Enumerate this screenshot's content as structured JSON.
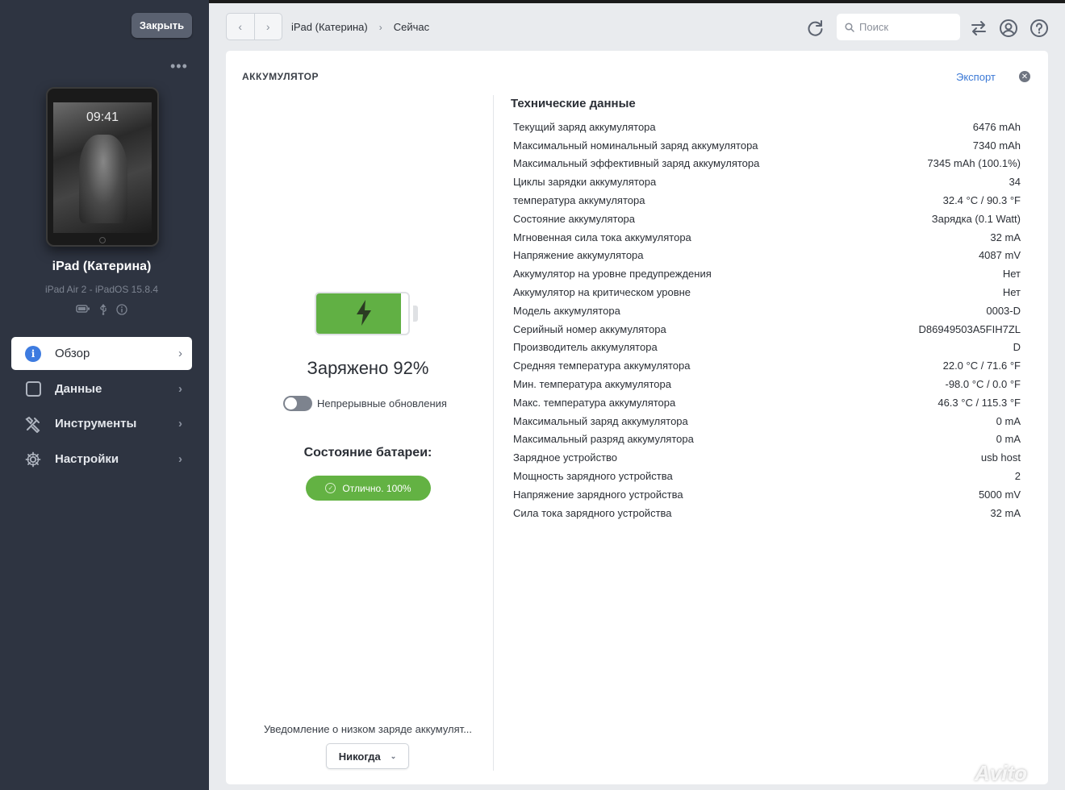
{
  "sidebar": {
    "close_label": "Закрыть",
    "more": "•••",
    "device": {
      "clock": "09:41",
      "name": "iPad (Катерина)",
      "model": "iPad Air 2 - iPadOS 15.8.4",
      "icons": [
        "battery-icon",
        "usb-icon",
        "info-icon"
      ]
    },
    "items": [
      {
        "label": "Обзор",
        "icon": "info-icon",
        "active": true
      },
      {
        "label": "Данные",
        "icon": "square-icon",
        "active": false
      },
      {
        "label": "Инструменты",
        "icon": "tools-icon",
        "active": false
      },
      {
        "label": "Настройки",
        "icon": "gear-icon",
        "active": false
      }
    ]
  },
  "toolbar": {
    "back": "‹",
    "forward": "›",
    "breadcrumb": [
      "iPad (Катерина)",
      "Сейчас"
    ],
    "search_placeholder": "Поиск"
  },
  "panel": {
    "title": "АККУМУЛЯТОР",
    "export_label": "Экспорт",
    "charge_percent": 92,
    "charged_text": "Заряжено 92%",
    "continuous_updates_label": "Непрерывные обновления",
    "continuous_updates_on": false,
    "state_title": "Состояние батареи:",
    "state_badge": "Отлично. 100%",
    "low_charge_label": "Уведомление о низком заряде аккумулят...",
    "low_charge_value": "Никогда"
  },
  "tech": {
    "title": "Технические данные",
    "rows": [
      {
        "label": "Текущий заряд аккумулятора",
        "value": "6476 mAh"
      },
      {
        "label": "Максимальный номинальный заряд аккумулятора",
        "value": "7340 mAh"
      },
      {
        "label": "Максимальный эффективный заряд аккумулятора",
        "value": "7345 mAh (100.1%)"
      },
      {
        "label": "Циклы зарядки аккумулятора",
        "value": "34"
      },
      {
        "label": "температура аккумулятора",
        "value": "32.4 °C / 90.3 °F"
      },
      {
        "label": "Состояние аккумулятора",
        "value": "Зарядка (0.1 Watt)"
      },
      {
        "label": "Мгновенная сила тока аккумулятора",
        "value": "32 mA"
      },
      {
        "label": "Напряжение аккумулятора",
        "value": "4087 mV"
      },
      {
        "label": "Аккумулятор на уровне предупреждения",
        "value": "Нет"
      },
      {
        "label": "Аккумулятор на критическом уровне",
        "value": "Нет"
      },
      {
        "label": "Модель аккумулятора",
        "value": "0003-D"
      },
      {
        "label": "Серийный номер аккумулятора",
        "value": "D86949503A5FIH7ZL"
      },
      {
        "label": "Производитель аккумулятора",
        "value": "D"
      },
      {
        "label": "Средняя температура аккумулятора",
        "value": "22.0 °C / 71.6 °F"
      },
      {
        "label": "Мин. температура аккумулятора",
        "value": "-98.0 °C / 0.0 °F"
      },
      {
        "label": "Макс. температура аккумулятора",
        "value": "46.3 °C / 115.3 °F"
      },
      {
        "label": "Максимальный заряд аккумулятора",
        "value": "0 mA"
      },
      {
        "label": "Максимальный разряд аккумулятора",
        "value": "0 mA"
      },
      {
        "label": "Зарядное устройство",
        "value": "usb host"
      },
      {
        "label": "Мощность зарядного устройства",
        "value": "2"
      },
      {
        "label": "Напряжение зарядного устройства",
        "value": "5000 mV"
      },
      {
        "label": "Сила тока зарядного устройства",
        "value": "32 mA"
      }
    ]
  },
  "watermark": "Avito",
  "colors": {
    "sidebar_bg": "#2e3441",
    "battery_green": "#61b044",
    "accent_blue": "#3b79d6"
  }
}
